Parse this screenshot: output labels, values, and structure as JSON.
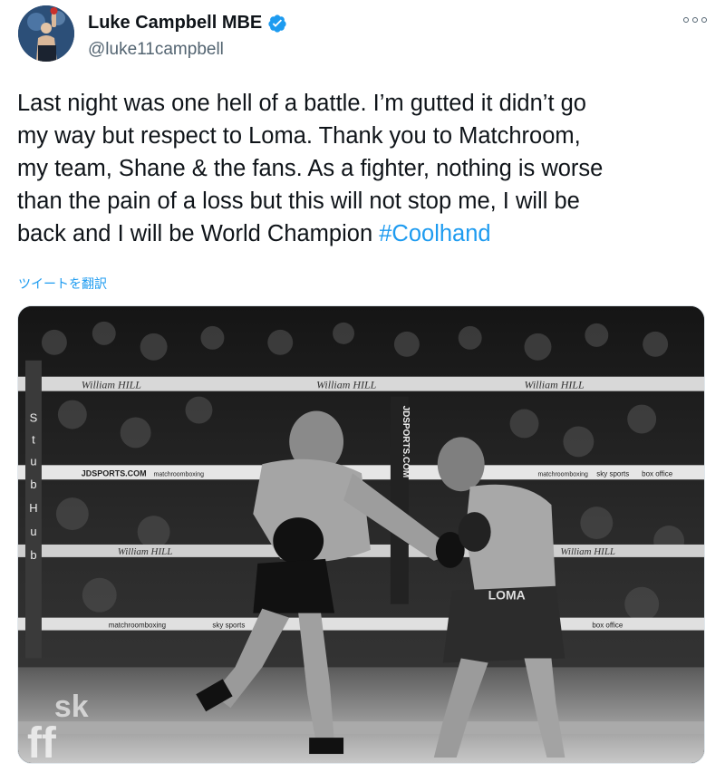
{
  "author": {
    "display_name": "Luke Campbell MBE",
    "handle": "@luke11campbell",
    "verified": true,
    "avatar_icon": "avatar-boxer-photo"
  },
  "tweet": {
    "text_lines": [
      "Last night was one hell of a battle. I’m gutted it didn’t go",
      "my way but respect to Loma. Thank you to Matchroom,",
      "my team, Shane & the fans. As a fighter, nothing is worse",
      "than the pain of a loss but this will not stop me, I will be",
      "back and I will be World Champion "
    ],
    "hashtag": "#Coolhand",
    "translate_label": "ツイートを翻訳",
    "more_icon": "more-dots-icon"
  },
  "photo": {
    "ring_banner_text": [
      "William HILL",
      "JDSPORTS.COM",
      "matchroomboxing",
      "sky sports",
      "box office",
      "JDSPORTS"
    ],
    "vertical_text_left": [
      "S",
      "t",
      "u",
      "b",
      "H",
      "u",
      "b"
    ],
    "vertical_text_post": "JDSPORTS.COM",
    "trunks_text": "LOMA",
    "floor_text": "ff",
    "floor_text_2": "sk"
  },
  "colors": {
    "link": "#1d9bf0",
    "verified": "#1d9bf0",
    "text": "#0f1419",
    "secondary": "#536471"
  }
}
